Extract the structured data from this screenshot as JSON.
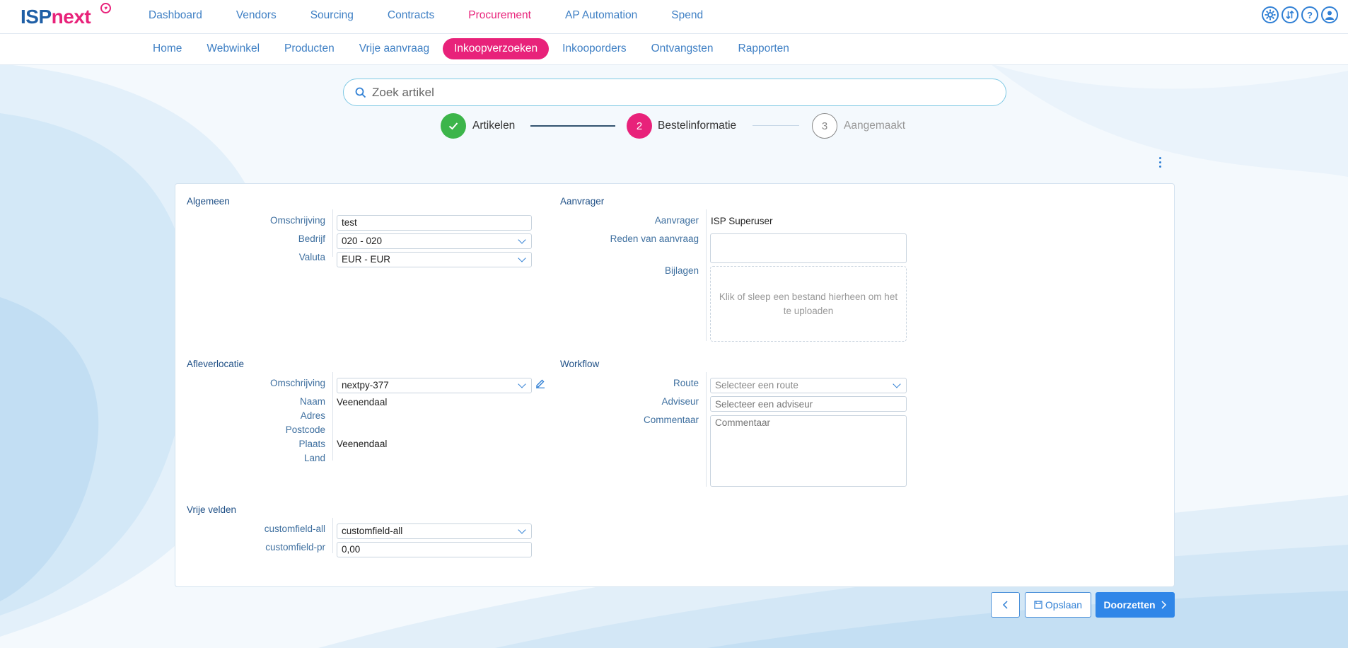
{
  "brand": {
    "isp": "ISP",
    "next": "next"
  },
  "main_nav": [
    {
      "label": "Dashboard",
      "active": false
    },
    {
      "label": "Vendors",
      "active": false
    },
    {
      "label": "Sourcing",
      "active": false
    },
    {
      "label": "Contracts",
      "active": false
    },
    {
      "label": "Procurement",
      "active": true
    },
    {
      "label": "AP Automation",
      "active": false
    },
    {
      "label": "Spend",
      "active": false
    }
  ],
  "top_icons": [
    "settings-icon",
    "swap-icon",
    "help-icon",
    "user-icon"
  ],
  "sub_nav": [
    {
      "label": "Home",
      "active": false
    },
    {
      "label": "Webwinkel",
      "active": false
    },
    {
      "label": "Producten",
      "active": false
    },
    {
      "label": "Vrije aanvraag",
      "active": false
    },
    {
      "label": "Inkoopverzoeken",
      "active": true
    },
    {
      "label": "Inkooporders",
      "active": false
    },
    {
      "label": "Ontvangsten",
      "active": false
    },
    {
      "label": "Rapporten",
      "active": false
    }
  ],
  "search": {
    "placeholder": "Zoek artikel"
  },
  "stepper": {
    "steps": [
      {
        "number": "",
        "label": "Artikelen",
        "state": "done"
      },
      {
        "number": "2",
        "label": "Bestelinformatie",
        "state": "active"
      },
      {
        "number": "3",
        "label": "Aangemaakt",
        "state": "pending"
      }
    ]
  },
  "colors": {
    "accent": "#e8227a",
    "primary": "#2f86e8",
    "done": "#3cb54a",
    "nav": "#3e7fc4"
  },
  "algemeen": {
    "title": "Algemeen",
    "omschrijving_label": "Omschrijving",
    "omschrijving_value": "test",
    "bedrijf_label": "Bedrijf",
    "bedrijf_value": "020 - 020",
    "valuta_label": "Valuta",
    "valuta_value": "EUR - EUR"
  },
  "aanvrager": {
    "title": "Aanvrager",
    "aanvrager_label": "Aanvrager",
    "aanvrager_value": "ISP Superuser",
    "reden_label": "Reden van aanvraag",
    "reden_value": "",
    "bijlagen_label": "Bijlagen",
    "bijlagen_drop": "Klik of sleep een bestand hierheen om het te uploaden"
  },
  "afleverlocatie": {
    "title": "Afleverlocatie",
    "omschrijving_label": "Omschrijving",
    "omschrijving_value": "nextpy-377",
    "naam_label": "Naam",
    "naam_value": "Veenendaal",
    "adres_label": "Adres",
    "adres_value": "",
    "postcode_label": "Postcode",
    "postcode_value": "",
    "plaats_label": "Plaats",
    "plaats_value": "Veenendaal",
    "land_label": "Land",
    "land_value": ""
  },
  "workflow": {
    "title": "Workflow",
    "route_label": "Route",
    "route_placeholder": "Selecteer een route",
    "adviseur_label": "Adviseur",
    "adviseur_placeholder": "Selecteer een adviseur",
    "commentaar_label": "Commentaar",
    "commentaar_placeholder": "Commentaar"
  },
  "vrije_velden": {
    "title": "Vrije velden",
    "cf_all_label": "customfield-all",
    "cf_all_value": "customfield-all",
    "cf_pr_label": "customfield-pr",
    "cf_pr_value": "0,00"
  },
  "actions": {
    "back_icon": "chevron-left-icon",
    "save_label": "Opslaan",
    "submit_label": "Doorzetten"
  }
}
